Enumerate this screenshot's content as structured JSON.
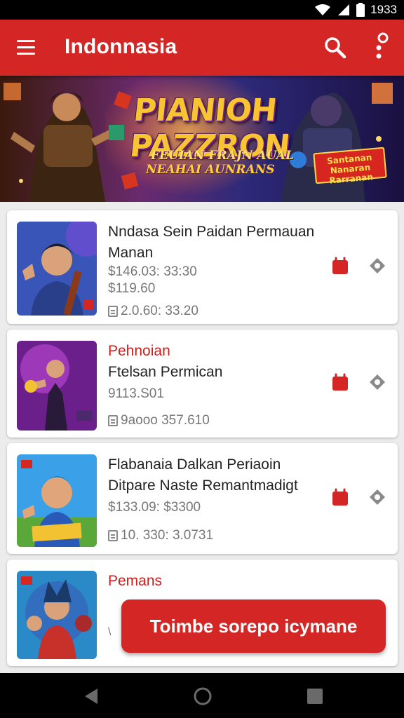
{
  "status_bar": {
    "time": "1933",
    "icons": [
      "wifi-icon",
      "signal-icon",
      "battery-icon"
    ]
  },
  "app_bar": {
    "title": "Indonnasia",
    "menu_icon": "menu-icon",
    "search_icon": "search-icon",
    "more_icon": "more-icon",
    "color": "#d32625"
  },
  "banner": {
    "title": "PIANIOH PAZZRON",
    "subtitle_1": "FEUIAN FRAJN AUAL",
    "subtitle_2": "NEAHAI AUNRANS",
    "badge": "Santanan Nanaran Rarranan"
  },
  "cards": [
    {
      "thumb_style": "guitar-boy",
      "line1": "Nndasa Sein Paidan Permauan",
      "line2": "Manan",
      "line3": "$146.03: 33:30",
      "line4": "$119.60",
      "meta": "2.0.60: 33.20"
    },
    {
      "thumb_style": "purple-warrior",
      "line1": "Pehnoian",
      "line2": "Ftelsan Permican",
      "line3": "9113.S01",
      "meta": "9aooo 357.610"
    },
    {
      "thumb_style": "field-boy",
      "line1": "Flabanaia Dalkan Periaoin",
      "line2": "Ditpare Naste Remantmadigt",
      "line3": "$133.09: $3300",
      "meta": "10. 330: 3.0731"
    },
    {
      "thumb_style": "hero-squad",
      "line1": "Pemans",
      "meta": "\\"
    }
  ],
  "cta": {
    "label": "Toimbe sorepo icymane"
  },
  "nav_bar": {
    "icons": [
      "back-icon",
      "home-icon",
      "recents-icon"
    ]
  },
  "accent_color": "#d32625"
}
